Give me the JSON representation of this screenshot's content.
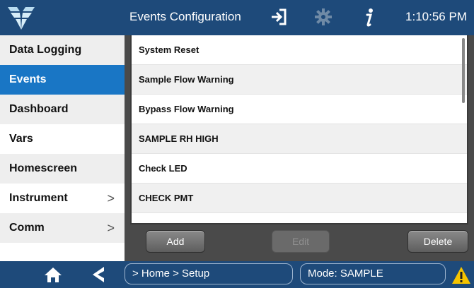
{
  "header": {
    "title": "Events Configuration",
    "time": "1:10:56 PM",
    "icons": [
      "logo-icon",
      "exit-icon",
      "gear-icon",
      "info-icon"
    ]
  },
  "sidebar": {
    "items": [
      {
        "label": "Data Logging",
        "chevron": ""
      },
      {
        "label": "Events",
        "chevron": "",
        "active": true
      },
      {
        "label": "Dashboard",
        "chevron": ""
      },
      {
        "label": "Vars",
        "chevron": ""
      },
      {
        "label": "Homescreen",
        "chevron": ""
      },
      {
        "label": "Instrument",
        "chevron": ">"
      },
      {
        "label": "Comm",
        "chevron": ">"
      }
    ]
  },
  "events": {
    "items": [
      "System Reset",
      "Sample Flow Warning",
      "Bypass Flow Warning",
      "SAMPLE RH HIGH",
      "Check LED",
      "CHECK PMT"
    ]
  },
  "buttons": {
    "add": "Add",
    "edit": "Edit",
    "delete": "Delete"
  },
  "footer": {
    "breadcrumb": "> Home > Setup",
    "mode": "Mode: SAMPLE",
    "icons": [
      "home-icon",
      "back-icon",
      "warning-icon"
    ]
  },
  "colors": {
    "bar": "#1e4a7a",
    "active": "#1976c5",
    "panel": "#4a4a4a",
    "warning": "#f5c400"
  }
}
